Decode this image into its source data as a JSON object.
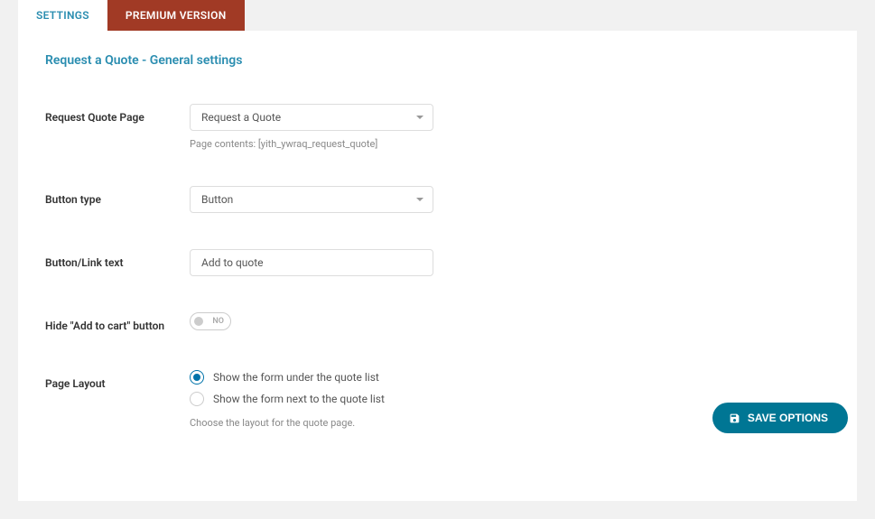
{
  "tabs": {
    "settings": "SETTINGS",
    "premium": "PREMIUM VERSION"
  },
  "panel": {
    "title": "Request a Quote - General settings"
  },
  "fields": {
    "request_quote_page": {
      "label": "Request Quote Page",
      "value": "Request a Quote",
      "helper": "Page contents: [yith_ywraq_request_quote]"
    },
    "button_type": {
      "label": "Button type",
      "value": "Button"
    },
    "button_link_text": {
      "label": "Button/Link text",
      "value": "Add to quote"
    },
    "hide_add_to_cart": {
      "label": "Hide \"Add to cart\" button",
      "toggle_text": "NO"
    },
    "page_layout": {
      "label": "Page Layout",
      "option1": "Show the form under the quote list",
      "option2": "Show the form next to the quote list",
      "helper": "Choose the layout for the quote page."
    }
  },
  "actions": {
    "save": "SAVE OPTIONS"
  }
}
